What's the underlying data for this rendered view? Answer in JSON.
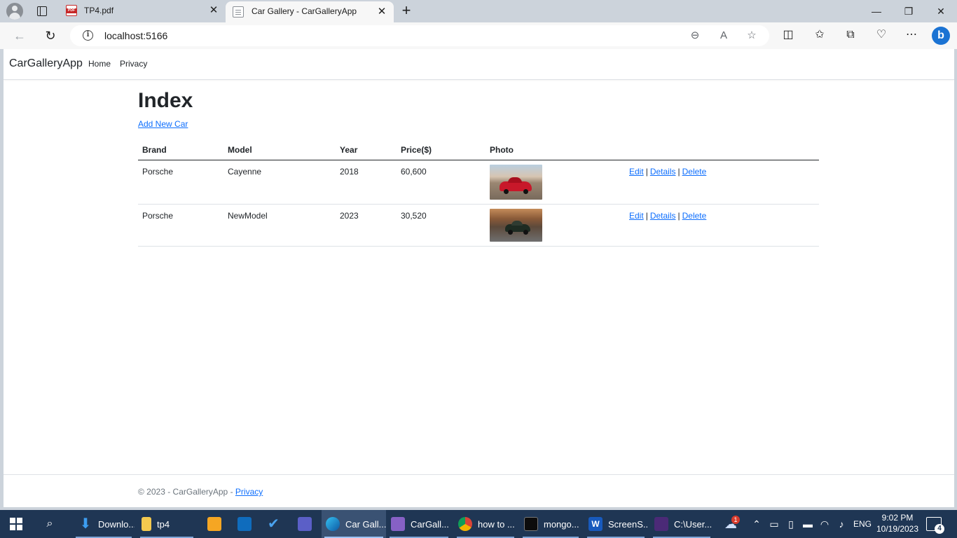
{
  "browser": {
    "tabs": [
      {
        "title": "TP4.pdf",
        "icon": "pdf-icon",
        "active": false
      },
      {
        "title": "Car Gallery - CarGalleryApp",
        "icon": "page-icon",
        "active": true
      }
    ],
    "url": "localhost:5166"
  },
  "app": {
    "brand": "CarGalleryApp",
    "nav": [
      "Home",
      "Privacy"
    ],
    "page_title": "Index",
    "add_link": "Add New Car",
    "table": {
      "headers": [
        "Brand",
        "Model",
        "Year",
        "Price($)",
        "Photo"
      ],
      "rows": [
        {
          "brand": "Porsche",
          "model": "Cayenne",
          "year": "2018",
          "price": "60,600",
          "photo": "red-porsche-photo"
        },
        {
          "brand": "Porsche",
          "model": "NewModel",
          "year": "2023",
          "price": "30,520",
          "photo": "dark-porsche-photo"
        }
      ],
      "actions": {
        "edit": "Edit",
        "details": "Details",
        "delete": "Delete",
        "separator": "|"
      }
    },
    "footer": {
      "text": "© 2023 - CarGalleryApp -",
      "link": "Privacy"
    }
  },
  "taskbar": {
    "items": [
      "Downlo...",
      "tp4",
      "Car Gall...",
      "CarGall...",
      "how to ...",
      "mongo...",
      "ScreenS...",
      "C:\\User..."
    ],
    "language": "ENG",
    "time": "9:02 PM",
    "date": "10/19/2023",
    "weather_badge": "1",
    "notification_count": "4"
  },
  "colors": {
    "link": "#0d6efd",
    "taskbar": "#1f3654",
    "tabstrip": "#ccd3db"
  }
}
